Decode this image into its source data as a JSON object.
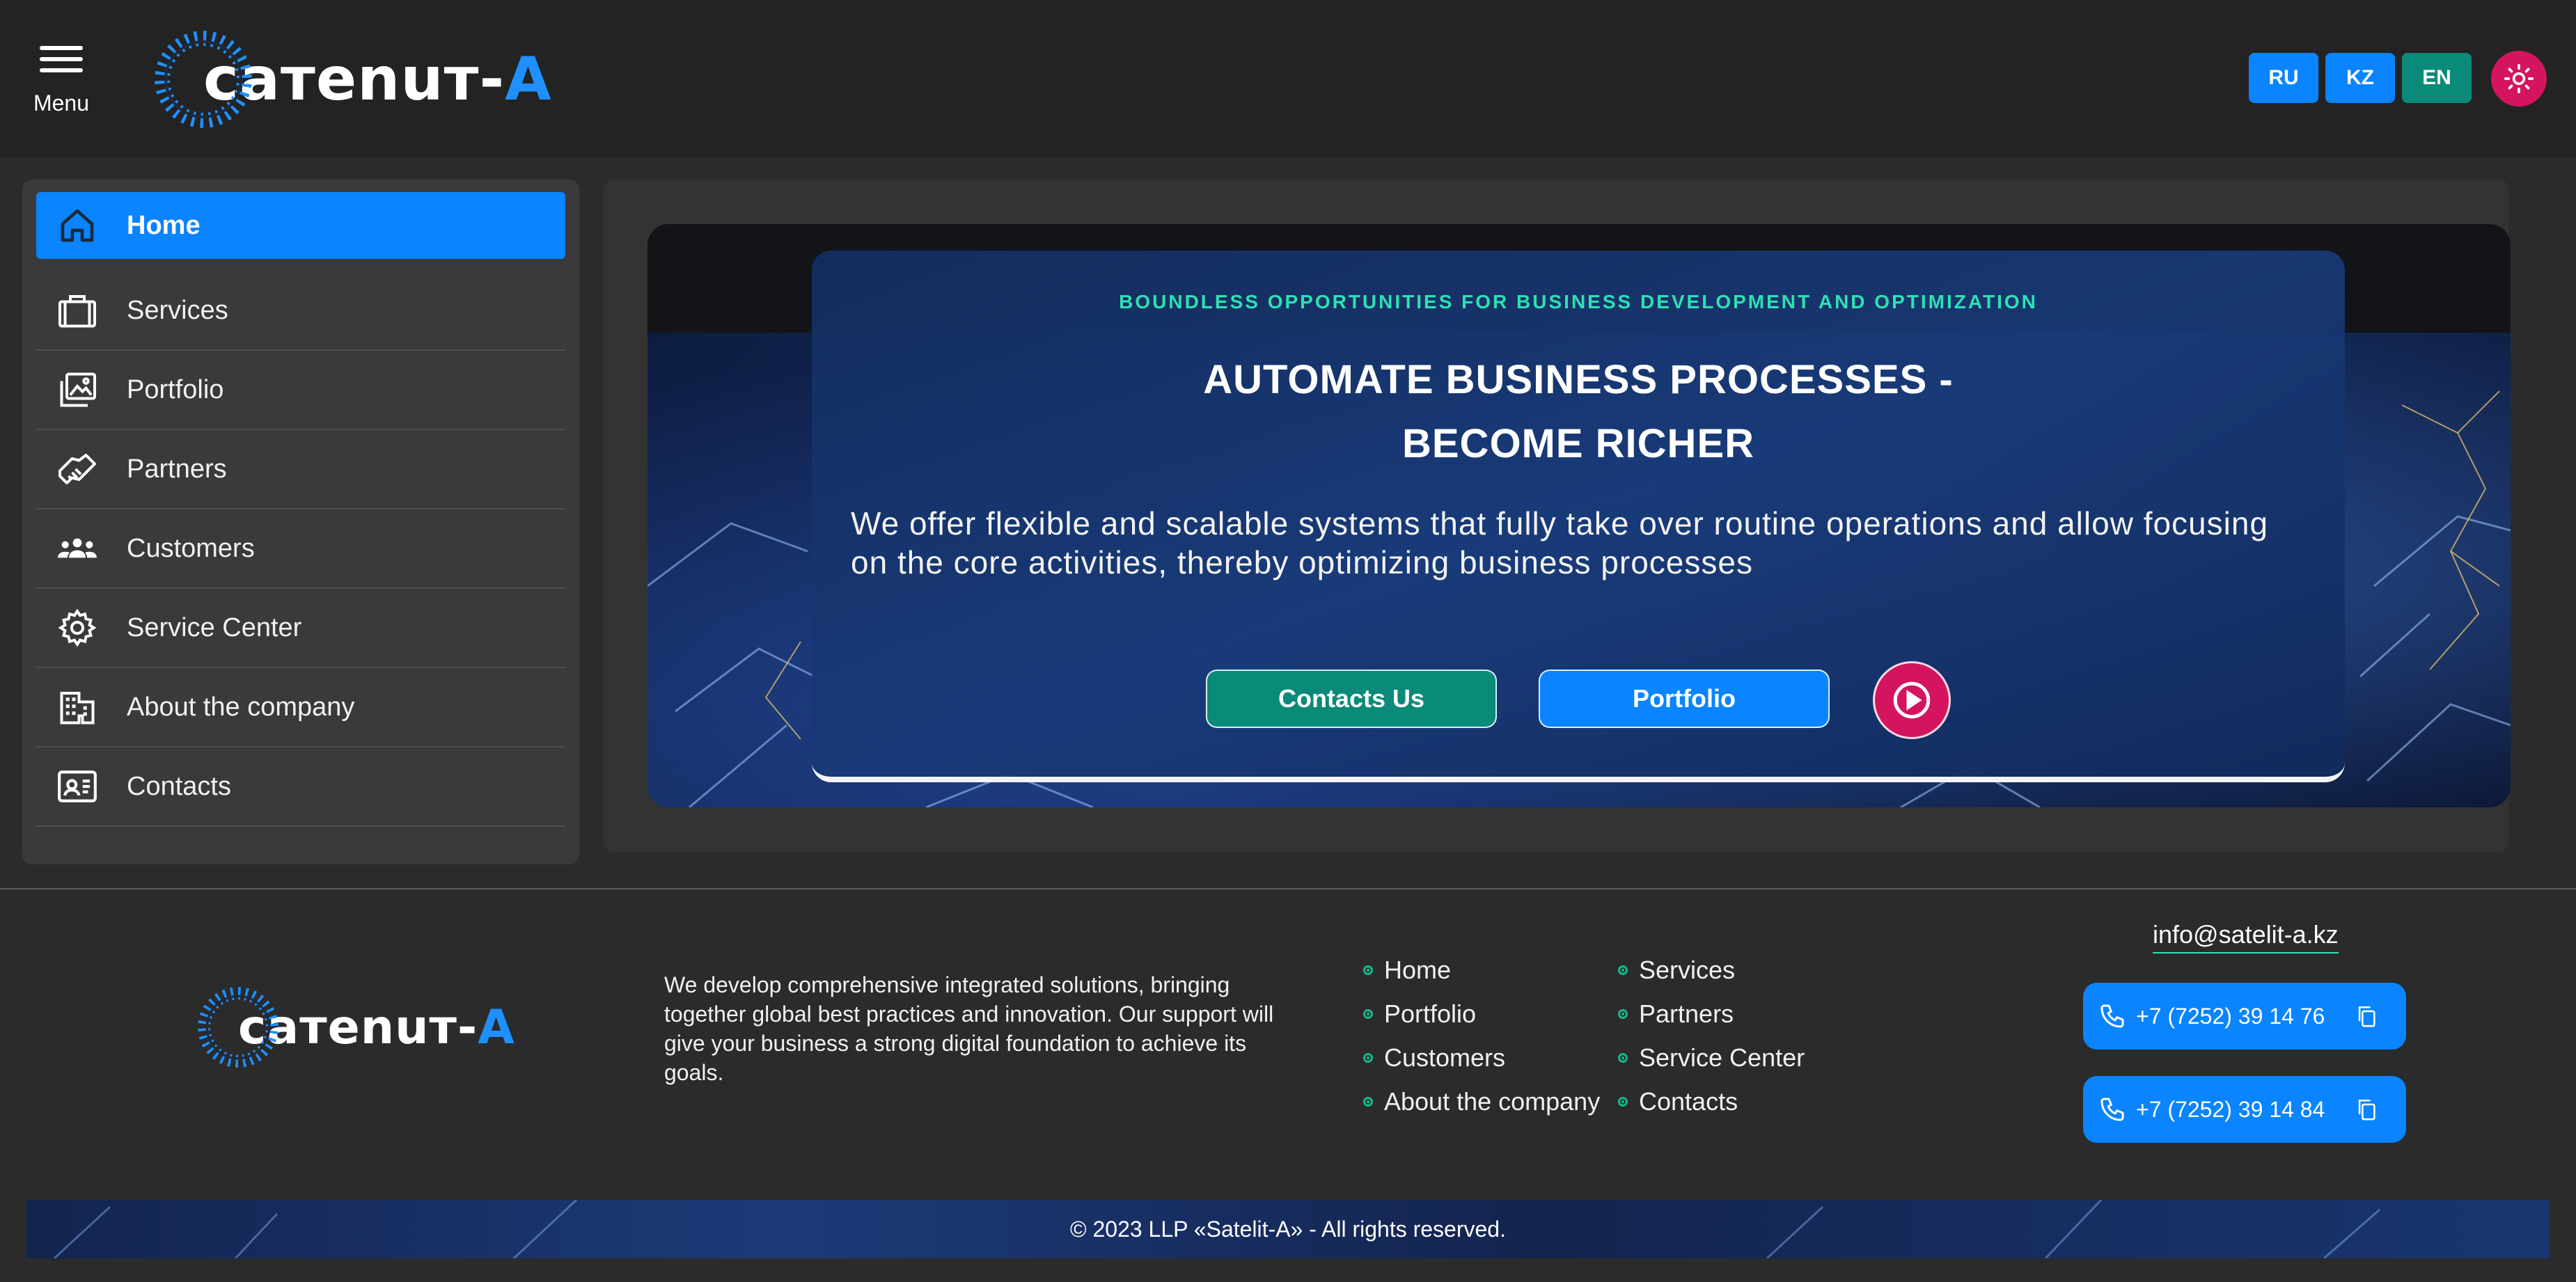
{
  "header": {
    "menu_label": "Menu",
    "logo": {
      "text_main": "caтenuт-",
      "text_accent": "A"
    },
    "languages": [
      "RU",
      "KZ",
      "EN"
    ],
    "theme_icon": "sun-icon"
  },
  "sidebar": {
    "items": [
      {
        "label": "Home",
        "icon": "home-icon",
        "active": true
      },
      {
        "label": "Services",
        "icon": "briefcase-icon"
      },
      {
        "label": "Portfolio",
        "icon": "gallery-icon"
      },
      {
        "label": "Partners",
        "icon": "handshake-icon"
      },
      {
        "label": "Customers",
        "icon": "people-icon"
      },
      {
        "label": "Service Center",
        "icon": "gear-icon"
      },
      {
        "label": "About the company",
        "icon": "building-icon"
      },
      {
        "label": "Contacts",
        "icon": "contact-card-icon"
      }
    ]
  },
  "hero": {
    "eyebrow": "BOUNDLESS OPPORTUNITIES FOR BUSINESS DEVELOPMENT AND OPTIMIZATION",
    "title_line1": "AUTOMATE BUSINESS PROCESSES -",
    "title_line2": "BECOME RICHER",
    "text": "We offer flexible and scalable systems that fully take over routine operations and allow focusing on the core activities, thereby optimizing business processes",
    "contacts_button": "Contacts Us",
    "portfolio_button": "Portfolio",
    "play_icon": "play-icon"
  },
  "footer": {
    "about": "We develop comprehensive integrated solutions, bringing together global best practices and innovation. Our support will give your business a strong digital foundation to achieve its goals.",
    "links_col1": [
      "Home",
      "Portfolio",
      "Customers",
      "About the company"
    ],
    "links_col2": [
      "Services",
      "Partners",
      "Service Center",
      "Contacts"
    ],
    "email": "info@satelit-a.kz",
    "phones": [
      "+7 (7252) 39 14 76",
      "+7 (7252) 39 14 84"
    ],
    "copyright": "© 2023 LLP «Satelit-A» - All rights reserved."
  },
  "colors": {
    "primary_blue": "#0a84ff",
    "teal": "#0a8a78",
    "accent_pink": "#d5145f",
    "eyebrow_green": "#2ee0b4"
  }
}
